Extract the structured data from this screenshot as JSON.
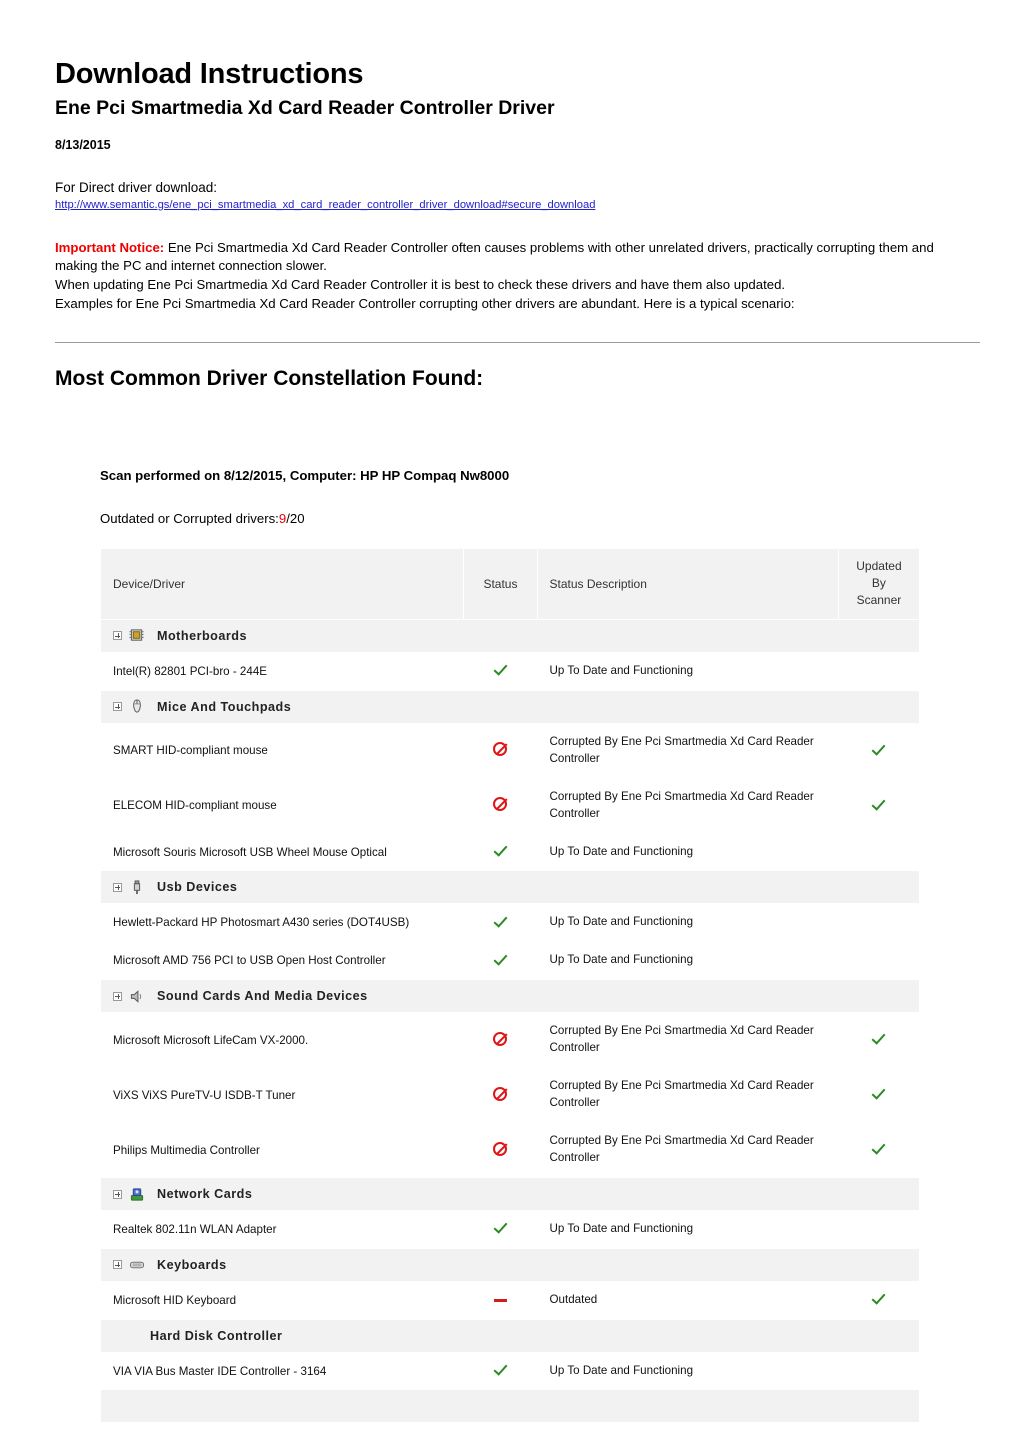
{
  "header": {
    "title": "Download Instructions",
    "subtitle": "Ene Pci Smartmedia Xd Card Reader Controller Driver",
    "date": "8/13/2015",
    "download_label": "For Direct driver download:",
    "download_url": "http://www.semantic.gs/ene_pci_smartmedia_xd_card_reader_controller_driver_download#secure_download"
  },
  "notice": {
    "flag": "Important Notice:",
    "line1": " Ene Pci Smartmedia Xd Card Reader Controller often causes problems with other unrelated drivers, practically corrupting them and making the PC and internet connection slower.",
    "line2": "When updating Ene Pci Smartmedia Xd Card Reader Controller it is best to check these drivers and have them also updated.",
    "line3": "Examples for Ene Pci Smartmedia Xd Card Reader Controller corrupting other drivers are abundant. Here is a typical scenario:"
  },
  "section": {
    "title": "Most Common Driver Constellation Found:",
    "scan_line": "Scan performed on 8/12/2015, Computer: HP HP Compaq Nw8000",
    "outdated_prefix": "Outdated or Corrupted drivers:",
    "outdated_count": "9",
    "outdated_total": "/20",
    "outdated_color": "#ee0000"
  },
  "table": {
    "columns": {
      "device": "Device/Driver",
      "status": "Status",
      "description": "Status Description",
      "updated": "Updated By Scanner"
    },
    "status_labels": {
      "ok": "Up To Date and Functioning",
      "corrupted": "Corrupted By Ene Pci Smartmedia Xd Card Reader Controller",
      "outdated": "Outdated"
    },
    "groups": [
      {
        "name": "Motherboards",
        "icon": "motherboard-chip-icon",
        "expandable": true,
        "rows": [
          {
            "device": "Intel(R) 82801 PCI-bro - 244E",
            "status": "ok",
            "description": "Up To Date and Functioning",
            "updated": ""
          }
        ]
      },
      {
        "name": "Mice And Touchpads",
        "icon": "mouse-icon",
        "expandable": true,
        "rows": [
          {
            "device": "SMART HID-compliant mouse",
            "status": "blocked",
            "description": "Corrupted By Ene Pci Smartmedia Xd Card Reader Controller",
            "updated": "ok"
          },
          {
            "device": "ELECOM HID-compliant mouse",
            "status": "blocked",
            "description": "Corrupted By Ene Pci Smartmedia Xd Card Reader Controller",
            "updated": "ok"
          },
          {
            "device": "Microsoft Souris Microsoft USB Wheel Mouse Optical",
            "status": "ok",
            "description": "Up To Date and Functioning",
            "updated": ""
          }
        ]
      },
      {
        "name": "Usb Devices",
        "icon": "usb-plug-icon",
        "expandable": true,
        "rows": [
          {
            "device": "Hewlett-Packard HP Photosmart A430 series (DOT4USB)",
            "status": "ok",
            "description": "Up To Date and Functioning",
            "updated": ""
          },
          {
            "device": "Microsoft AMD 756 PCI to USB Open Host Controller",
            "status": "ok",
            "description": "Up To Date and Functioning",
            "updated": ""
          }
        ]
      },
      {
        "name": "Sound Cards And Media Devices",
        "icon": "speaker-icon",
        "expandable": true,
        "rows": [
          {
            "device": "Microsoft Microsoft LifeCam VX-2000.",
            "status": "blocked",
            "description": "Corrupted By Ene Pci Smartmedia Xd Card Reader Controller",
            "updated": "ok"
          },
          {
            "device": "ViXS ViXS PureTV-U ISDB-T Tuner",
            "status": "blocked",
            "description": "Corrupted By Ene Pci Smartmedia Xd Card Reader Controller",
            "updated": "ok"
          },
          {
            "device": "Philips Multimedia Controller",
            "status": "blocked",
            "description": "Corrupted By Ene Pci Smartmedia Xd Card Reader Controller",
            "updated": "ok"
          }
        ]
      },
      {
        "name": "Network Cards",
        "icon": "network-card-icon",
        "expandable": true,
        "rows": [
          {
            "device": "Realtek 802.11n WLAN Adapter",
            "status": "ok",
            "description": "Up To Date and Functioning",
            "updated": ""
          }
        ]
      },
      {
        "name": "Keyboards",
        "icon": "keyboard-icon",
        "expandable": true,
        "rows": [
          {
            "device": "Microsoft HID Keyboard",
            "status": "dash",
            "description": "Outdated",
            "updated": "ok"
          }
        ]
      },
      {
        "name": "Hard Disk Controller",
        "icon": "",
        "expandable": false,
        "rows": [
          {
            "device": "VIA VIA Bus Master IDE Controller - 3164",
            "status": "ok",
            "description": "Up To Date and Functioning",
            "updated": ""
          }
        ]
      }
    ]
  }
}
